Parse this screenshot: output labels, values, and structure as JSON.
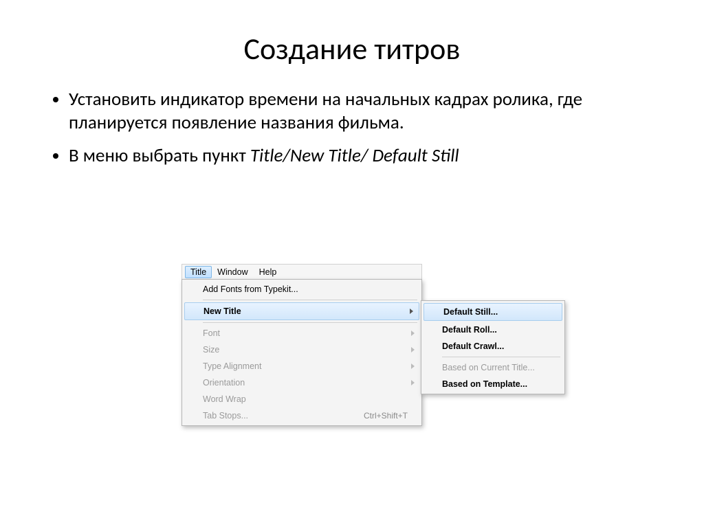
{
  "slide": {
    "title": "Создание титров",
    "bullets": [
      "Установить индикатор времени на начальных кадрах ролика, где планируется появление названия фильма.",
      "В меню выбрать пункт "
    ],
    "bullet2_italic": "Title/New Title/ Default Still"
  },
  "menubar": {
    "items": [
      "Title",
      "Window",
      "Help"
    ]
  },
  "menu": {
    "add_fonts": "Add Fonts from Typekit...",
    "new_title": "New Title",
    "font": "Font",
    "size": "Size",
    "type_alignment": "Type Alignment",
    "orientation": "Orientation",
    "word_wrap": "Word Wrap",
    "tab_stops": "Tab Stops...",
    "tab_stops_shortcut": "Ctrl+Shift+T"
  },
  "submenu": {
    "default_still": "Default Still...",
    "default_roll": "Default Roll...",
    "default_crawl": "Default Crawl...",
    "based_on_current": "Based on Current Title...",
    "based_on_template": "Based on Template..."
  }
}
